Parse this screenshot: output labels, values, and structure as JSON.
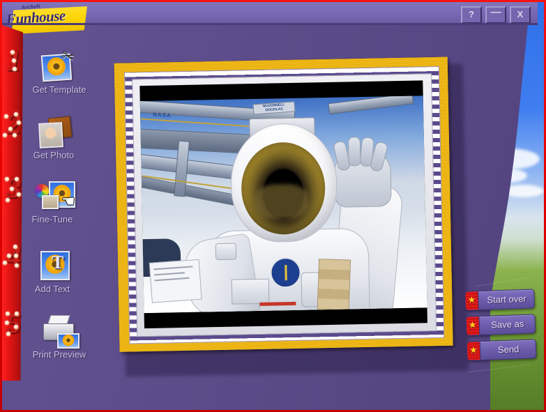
{
  "window": {
    "app_title": "ArcSoft Funhouse",
    "logo_brand": "ArcSoft",
    "logo_name": "Funhouse",
    "buttons": [
      {
        "name": "help-button",
        "glyph": "?"
      },
      {
        "name": "minimize-button",
        "glyph": "—"
      },
      {
        "name": "close-button",
        "glyph": "X"
      }
    ]
  },
  "sidebar": {
    "steps": [
      "1",
      "2",
      "3",
      "4",
      "5"
    ],
    "items": [
      {
        "label": "Get Template",
        "icon": "template-scissors-icon",
        "step": "1"
      },
      {
        "label": "Get Photo",
        "icon": "photo-album-icon",
        "step": "2"
      },
      {
        "label": "Fine-Tune",
        "icon": "color-wheel-photo-icon",
        "step": "3"
      },
      {
        "label": "Add Text",
        "icon": "text-tool-icon",
        "step": "4"
      },
      {
        "label": "Print Preview",
        "icon": "printer-icon",
        "step": "5"
      }
    ]
  },
  "canvas": {
    "frame_style": "gold-striped-matte",
    "photo_alt": "Astronaut on spacewalk with gold visor, space shuttle truss and Earth behind",
    "photo_text": {
      "nasa": "NASA",
      "plate_line1": "McDONNELL",
      "plate_line2": "DOUGLAS"
    }
  },
  "actions": [
    {
      "label": "Start over",
      "icon": "star-icon"
    },
    {
      "label": "Save as",
      "icon": "star-icon"
    },
    {
      "label": "Send",
      "icon": "star-icon"
    }
  ],
  "cursor": {
    "type": "hand-cursor",
    "glyph": "☚"
  },
  "colors": {
    "window_border": "#e00000",
    "panel_purple": "#5b4a8c",
    "titlebar_purple": "#7567b2",
    "logo_yellow": "#fdd400",
    "frame_gold": "#e8b210",
    "label_text": "#c5bde4",
    "marquee_red": "#c8201c",
    "star_yellow": "#ffd21e"
  }
}
